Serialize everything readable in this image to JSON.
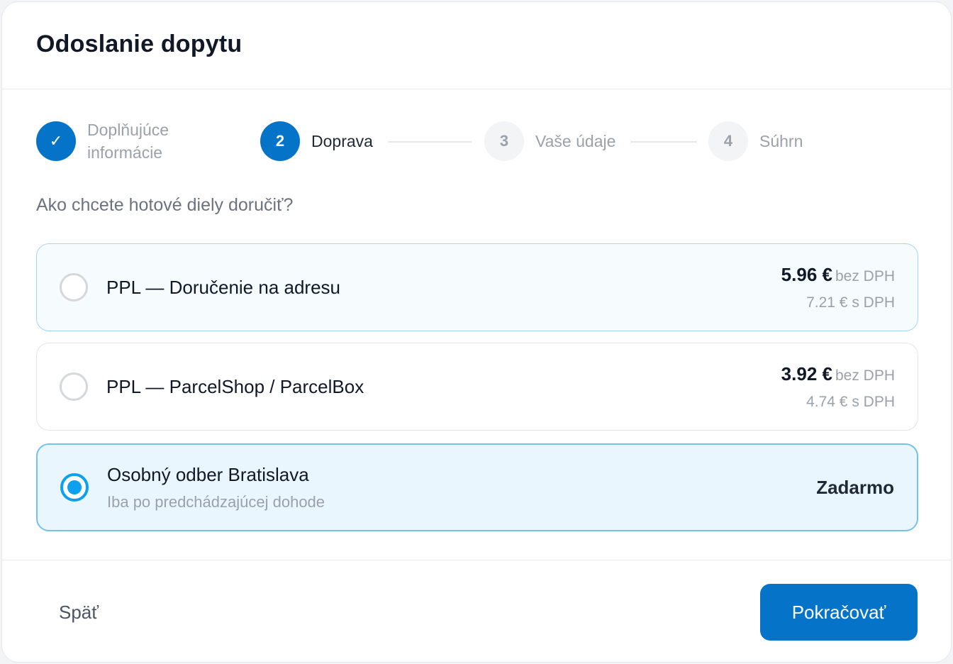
{
  "modal": {
    "title": "Odoslanie dopytu"
  },
  "stepper": {
    "steps": [
      {
        "number": "✓",
        "label_line1": "Doplňujúce",
        "label_line2": "informácie",
        "state": "done"
      },
      {
        "number": "2",
        "label": "Doprava",
        "state": "active"
      },
      {
        "number": "3",
        "label": "Vaše údaje",
        "state": "pending"
      },
      {
        "number": "4",
        "label": "Súhrn",
        "state": "pending"
      }
    ]
  },
  "question": "Ako chcete hotové diely doručiť?",
  "options": [
    {
      "name": "PPL — Doručenie na adresu",
      "price": "5.96 €",
      "price_unit": "bez DPH",
      "price_vat": "7.21 € s DPH",
      "selected": false
    },
    {
      "name": "PPL — ParcelShop / ParcelBox",
      "price": "3.92 €",
      "price_unit": "bez DPH",
      "price_vat": "4.74 € s DPH",
      "selected": false
    },
    {
      "name": "Osobný odber Bratislava",
      "subtitle": "Iba po predchádzajúcej dohode",
      "price_label": "Zadarmo",
      "selected": true
    }
  ],
  "footer": {
    "back_label": "Späť",
    "next_label": "Pokračovať"
  },
  "colors": {
    "primary": "#0573c7",
    "radio_selected": "#0ea0f0",
    "selected_bg": "#eaf6fd"
  }
}
